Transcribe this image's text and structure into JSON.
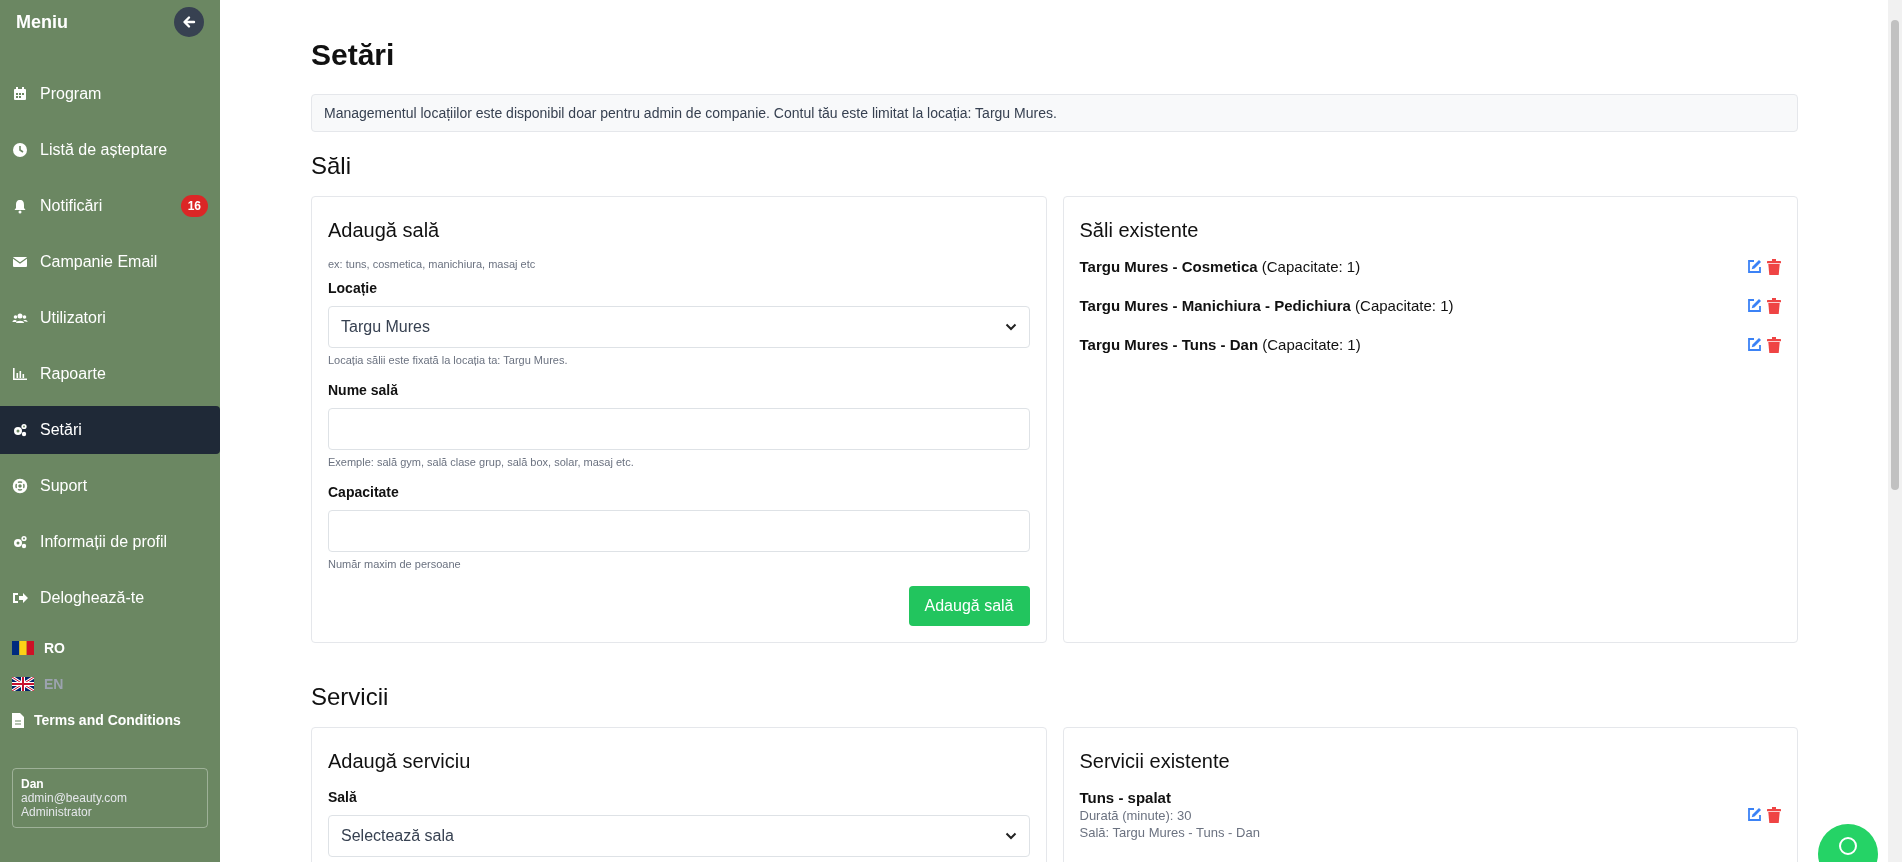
{
  "sidebar": {
    "title": "Meniu",
    "items": [
      {
        "label": "Program",
        "selected": false
      },
      {
        "label": "Listă de așteptare",
        "selected": false
      },
      {
        "label": "Notificări",
        "selected": false,
        "badge": "16"
      },
      {
        "label": "Campanie Email",
        "selected": false
      },
      {
        "label": "Utilizatori",
        "selected": false
      },
      {
        "label": "Rapoarte",
        "selected": false
      },
      {
        "label": "Setări",
        "selected": true
      },
      {
        "label": "Suport",
        "selected": false
      },
      {
        "label": "Informații de profil",
        "selected": false
      },
      {
        "label": "Deloghează-te",
        "selected": false
      }
    ],
    "languages": [
      {
        "code": "RO",
        "selected": true
      },
      {
        "code": "EN",
        "selected": false
      }
    ],
    "terms": "Terms and Conditions",
    "user": {
      "name": "Dan",
      "email": "admin@beauty.com",
      "role": "Administrator"
    }
  },
  "page": {
    "title": "Setări",
    "notice": "Managementul locațiilor este disponibil doar pentru admin de companie. Contul tău este limitat la locația: Targu Mures.",
    "sections": [
      {
        "heading": "Săli",
        "form": {
          "title": "Adaugă sală",
          "hint": "ex: tuns, cosmetica, manichiura, masaj etc",
          "fields": [
            {
              "kind": "select",
              "label": "Locație",
              "value": "Targu Mures",
              "help": "Locația sălii este fixată la locația ta: Targu Mures."
            },
            {
              "kind": "input",
              "label": "Nume sală",
              "help": "Exemple: sală gym, sală clase grup, sală box, solar, masaj etc."
            },
            {
              "kind": "input",
              "label": "Capacitate",
              "help": "Număr maxim de persoane"
            }
          ],
          "button": "Adaugă sală"
        },
        "list": {
          "title": "Săli existente",
          "items": [
            {
              "kind": "room",
              "lines": [
                "**Targu Mures - Cosmetica** (Capacitate: 1)"
              ]
            },
            {
              "kind": "room",
              "lines": [
                "**Targu Mures - Manichiura - Pedichiura** (Capacitate: 1)"
              ]
            },
            {
              "kind": "room",
              "lines": [
                "**Targu Mures - Tuns - Dan** (Capacitate: 1)"
              ]
            }
          ]
        }
      },
      {
        "heading": "Servicii",
        "form": {
          "title": "Adaugă serviciu",
          "fields": [
            {
              "kind": "select",
              "label": "Sală",
              "value": "Selectează sala"
            }
          ]
        },
        "list": {
          "title": "Servicii existente",
          "items": [
            {
              "kind": "service",
              "lines": [
                "Tuns - spalat",
                "Durată (minute): 30",
                "Sală: Targu Mures - Tuns - Dan"
              ]
            }
          ]
        }
      }
    ]
  }
}
